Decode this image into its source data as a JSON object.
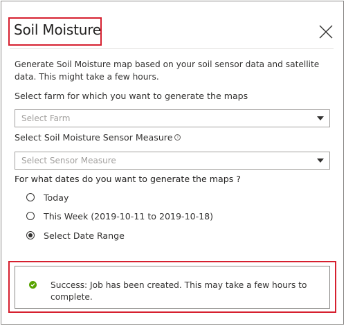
{
  "panel": {
    "title": "Soil Moisture",
    "close_icon": "close-icon",
    "description": "Generate Soil Moisture map based on your soil sensor data and satellite data. This might take a few hours."
  },
  "farm": {
    "label": "Select farm for which you want to generate the maps",
    "placeholder": "Select Farm"
  },
  "sensor": {
    "label": "Select Soil Moisture Sensor Measure",
    "info_icon": "info-icon",
    "placeholder": "Select Sensor Measure"
  },
  "dates": {
    "question": "For what dates do you want to generate the maps ?",
    "options": [
      {
        "label": "Today",
        "checked": false
      },
      {
        "label": "This Week (2019-10-11 to 2019-10-18)",
        "checked": false
      },
      {
        "label": "Select Date Range",
        "checked": true
      }
    ]
  },
  "status": {
    "icon": "success-check-icon",
    "color": "#57a300",
    "message": "Success: Job has been created. This may take a few hours to complete."
  },
  "colors": {
    "highlight": "#d6202f",
    "border": "#8a8886"
  }
}
